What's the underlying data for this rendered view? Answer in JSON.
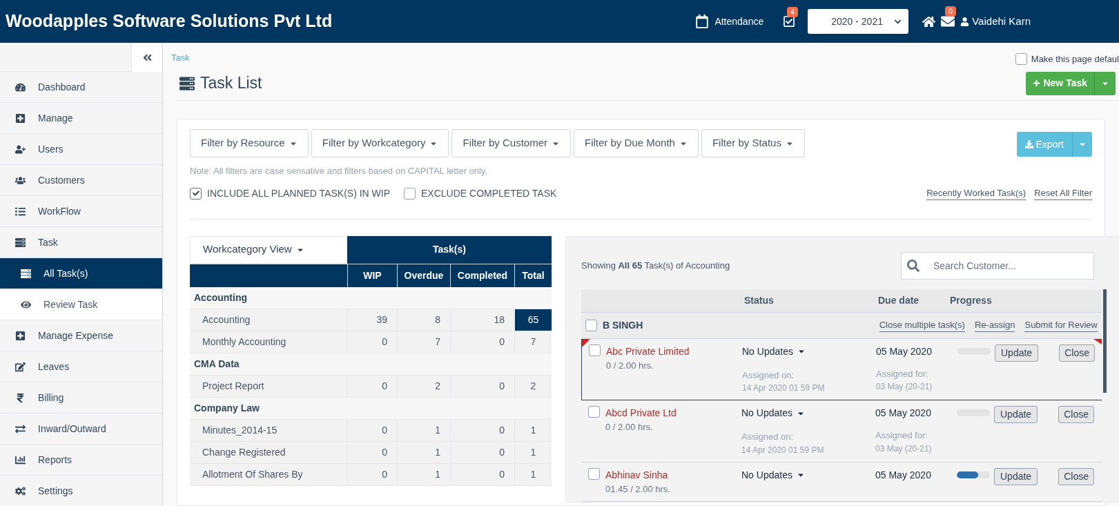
{
  "header": {
    "brand": "Woodapples Software Solutions Pvt Ltd",
    "attendance": "Attendance",
    "task_badge": "4",
    "year": "2020 - 2021",
    "mail_badge": "0",
    "user": "Vaidehi Karn"
  },
  "sidebar": {
    "items": [
      {
        "label": "Dashboard",
        "selected": false
      },
      {
        "label": "Manage",
        "selected": false
      },
      {
        "label": "Users",
        "selected": false
      },
      {
        "label": "Customers",
        "selected": false
      },
      {
        "label": "WorkFlow",
        "selected": false
      },
      {
        "label": "Task",
        "selected": false,
        "children": [
          {
            "label": "All Task(s)",
            "selected": true
          },
          {
            "label": "Review Task",
            "selected": false
          }
        ]
      },
      {
        "label": "Manage Expense",
        "selected": false
      },
      {
        "label": "Leaves",
        "selected": false
      },
      {
        "label": "Billing",
        "selected": false
      },
      {
        "label": "Inward/Outward",
        "selected": false
      },
      {
        "label": "Reports",
        "selected": false
      },
      {
        "label": "Settings",
        "selected": false
      }
    ]
  },
  "breadcrumb": "Task",
  "make_default": {
    "label": "Make this page defaul",
    "checked": false
  },
  "page_title": "Task List",
  "new_task_button": "New Task",
  "filters": [
    "Filter by Resource",
    "Filter by Workcategory",
    "Filter by Customer",
    "Filter by Due Month",
    "Filter by Status"
  ],
  "export_button": "Export",
  "note": "Note: All filters are case sensative and filters based on CAPITAL letter only.",
  "options": [
    {
      "label": "INCLUDE ALL PLANNED TASK(S) IN WIP",
      "checked": true
    },
    {
      "label": "EXCLUDE COMPLETED TASK",
      "checked": false
    }
  ],
  "links": [
    "Recently Worked Task(s)",
    "Reset All Filter"
  ],
  "summary": {
    "view_label": "Workcategory View",
    "group_header": "Task(s)",
    "columns": [
      "WIP",
      "Overdue",
      "Completed",
      "Total"
    ],
    "groups": [
      {
        "name": "Accounting",
        "rows": [
          {
            "name": "Accounting",
            "wip": "39",
            "overdue": "8",
            "completed": "18",
            "total": "65",
            "selected": true
          },
          {
            "name": "Monthly Accounting",
            "wip": "0",
            "overdue": "7",
            "completed": "0",
            "total": "7",
            "selected": false
          }
        ]
      },
      {
        "name": "CMA Data",
        "rows": [
          {
            "name": "Project Report",
            "wip": "0",
            "overdue": "2",
            "completed": "0",
            "total": "2",
            "selected": false
          }
        ]
      },
      {
        "name": "Company Law",
        "rows": [
          {
            "name": "Minutes_2014-15",
            "wip": "0",
            "overdue": "1",
            "completed": "0",
            "total": "1",
            "selected": false
          },
          {
            "name": "Change Registered",
            "wip": "0",
            "overdue": "1",
            "completed": "0",
            "total": "1",
            "selected": false
          },
          {
            "name": "Allotment Of Shares By",
            "wip": "0",
            "overdue": "1",
            "completed": "0",
            "total": "1",
            "selected": false
          }
        ]
      }
    ]
  },
  "tasks": {
    "showing": "Showing **All 65** Task(s) of Accounting",
    "search_placeholder": "Search Customer...",
    "columns": [
      "Status",
      "Due date",
      "Progress"
    ],
    "group": {
      "name": "B SINGH",
      "checked": false,
      "actions": [
        "Close multiple task(s)",
        "Re-assign",
        "Submit for Review"
      ]
    },
    "rows": [
      {
        "customer": "Abc Private Limited",
        "hours": "0 / 2.00 hrs.",
        "status": "No Updates",
        "due_date": "05 May 2020",
        "assigned_on_label": "Assigned on:",
        "assigned_on": "14 Apr 2020 01 59 PM",
        "assigned_for_label": "Assigned for:",
        "assigned_for": "03 May (20-21)",
        "level": 0,
        "flagged": true,
        "checked": false,
        "update_button": "Update",
        "close_button": "Close"
      },
      {
        "customer": "Abcd Private Ltd",
        "hours": "0 / 2.00 hrs.",
        "status": "No Updates",
        "due_date": "05 May 2020",
        "assigned_on_label": "Assigned on:",
        "assigned_on": "14 Apr 2020 01 59 PM",
        "assigned_for_label": "Assigned for:",
        "assigned_for": "03 May (20-21)",
        "level": 0,
        "flagged": false,
        "checked": false,
        "update_button": "Update",
        "close_button": "Close"
      },
      {
        "customer": "Abhinav Sinha",
        "hours": "01.45 / 2.00 hrs.",
        "status": "No Updates",
        "due_date": "05 May 2020",
        "level": 0.65,
        "flagged": false,
        "checked": false,
        "update_button": "Update",
        "close_button": "Close"
      }
    ]
  }
}
